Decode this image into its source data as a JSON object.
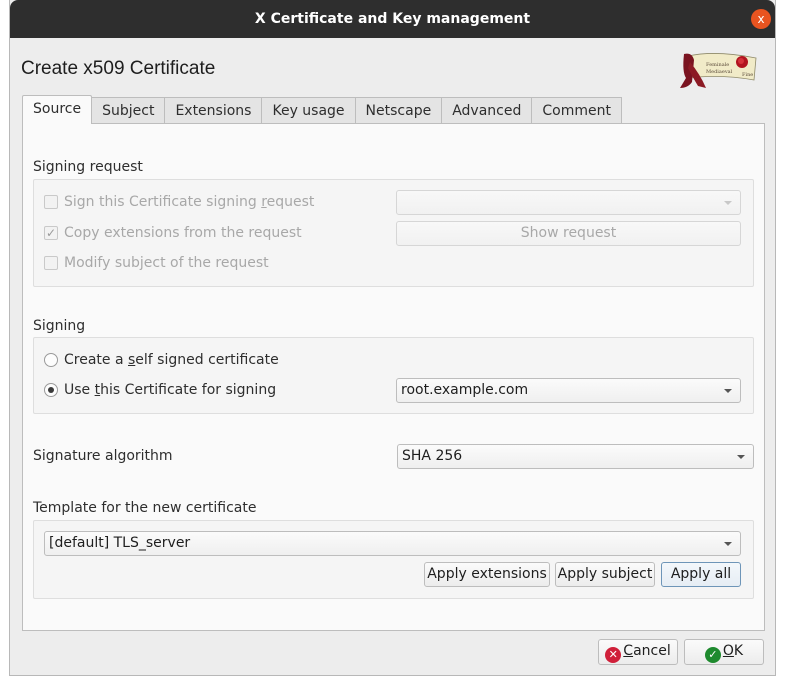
{
  "window": {
    "title": "X Certificate and Key management",
    "close_label": "x"
  },
  "dialog": {
    "title": "Create x509 Certificate",
    "logo": "scroll-seal-logo"
  },
  "tabs": [
    {
      "label": "Source",
      "active": true
    },
    {
      "label": "Subject",
      "active": false
    },
    {
      "label": "Extensions",
      "active": false
    },
    {
      "label": "Key usage",
      "active": false
    },
    {
      "label": "Netscape",
      "active": false
    },
    {
      "label": "Advanced",
      "active": false
    },
    {
      "label": "Comment",
      "active": false
    }
  ],
  "signing_request": {
    "label": "Signing request",
    "sign_csr": {
      "label_pre": "Sign this Certificate signing ",
      "label_u": "r",
      "label_post": "equest",
      "checked": false,
      "enabled": false
    },
    "copy_extensions": {
      "label": "Copy extensions from the request",
      "checked": true,
      "enabled": false
    },
    "modify_subject": {
      "label": "Modify subject of the request",
      "checked": false,
      "enabled": false
    },
    "request_select": {
      "value": ""
    },
    "show_request_label": "Show request"
  },
  "signing": {
    "label": "Signing",
    "self_signed": {
      "label_pre": "Create a ",
      "label_u": "s",
      "label_post": "elf signed certificate",
      "selected": false
    },
    "use_cert": {
      "label_pre": "Use ",
      "label_u": "t",
      "label_post": "his Certificate for signing",
      "selected": true
    },
    "ca_select": {
      "value": "root.example.com"
    }
  },
  "signature": {
    "label": "Signature algorithm",
    "value": "SHA 256"
  },
  "template": {
    "label": "Template for the new certificate",
    "value": "[default] TLS_server",
    "apply_extensions_label": "Apply extensions",
    "apply_subject_label": "Apply subject",
    "apply_all_label": "Apply all"
  },
  "footer": {
    "cancel_u": "C",
    "cancel_rest": "ancel",
    "ok_u": "O",
    "ok_rest": "K",
    "colors": {
      "cancel_icon": "#d0203a",
      "ok_icon": "#1e8a2e"
    }
  }
}
